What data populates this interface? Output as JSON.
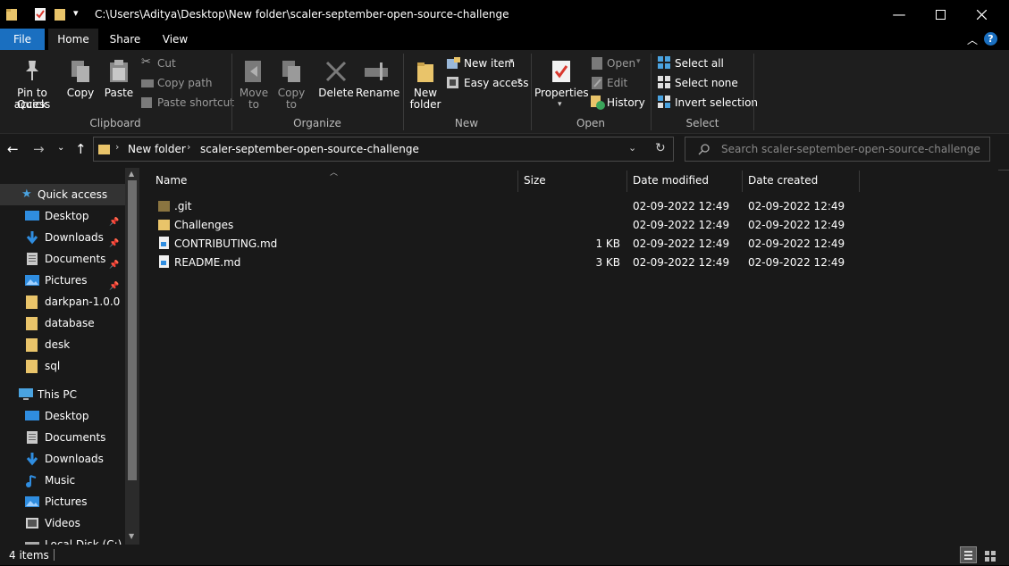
{
  "titlebar": {
    "path": "C:\\Users\\Aditya\\Desktop\\New folder\\scaler-september-open-source-challenge",
    "qat_dropdown": "▾"
  },
  "tabs": {
    "file": "File",
    "home": "Home",
    "share": "Share",
    "view": "View"
  },
  "ribbon": {
    "clipboard": {
      "pin_line1": "Pin to Quick",
      "pin_line2": "access",
      "copy": "Copy",
      "paste": "Paste",
      "cut": "Cut",
      "copy_path": "Copy path",
      "paste_shortcut": "Paste shortcut",
      "label": "Clipboard"
    },
    "organize": {
      "move_line1": "Move",
      "move_line2": "to",
      "copy_line1": "Copy",
      "copy_line2": "to",
      "delete": "Delete",
      "rename": "Rename",
      "label": "Organize"
    },
    "new": {
      "folder_line1": "New",
      "folder_line2": "folder",
      "new_item": "New item",
      "easy_access": "Easy access",
      "label": "New"
    },
    "open": {
      "properties": "Properties",
      "open": "Open",
      "edit": "Edit",
      "history": "History",
      "label": "Open"
    },
    "select": {
      "select_all": "Select all",
      "select_none": "Select none",
      "invert": "Invert selection",
      "label": "Select"
    }
  },
  "address": {
    "crumbs": [
      "New folder",
      "scaler-september-open-source-challenge"
    ],
    "search_placeholder": "Search scaler-september-open-source-challenge"
  },
  "nav": {
    "quick_access": "Quick access",
    "quick_items": [
      {
        "label": "Desktop",
        "icon": "desktop-icon",
        "pinned": true
      },
      {
        "label": "Downloads",
        "icon": "download-icon",
        "pinned": true
      },
      {
        "label": "Documents",
        "icon": "documents-icon",
        "pinned": true
      },
      {
        "label": "Pictures",
        "icon": "pictures-icon",
        "pinned": true
      },
      {
        "label": "darkpan-1.0.0",
        "icon": "folder-icon",
        "pinned": false
      },
      {
        "label": "database",
        "icon": "folder-icon",
        "pinned": false
      },
      {
        "label": "desk",
        "icon": "folder-icon",
        "pinned": false
      },
      {
        "label": "sql",
        "icon": "folder-icon",
        "pinned": false
      }
    ],
    "this_pc": "This PC",
    "pc_items": [
      {
        "label": "Desktop",
        "icon": "desktop-icon"
      },
      {
        "label": "Documents",
        "icon": "documents-icon"
      },
      {
        "label": "Downloads",
        "icon": "download-icon"
      },
      {
        "label": "Music",
        "icon": "music-icon"
      },
      {
        "label": "Pictures",
        "icon": "pictures-icon"
      },
      {
        "label": "Videos",
        "icon": "videos-icon"
      },
      {
        "label": "Local Disk (C:)",
        "icon": "drive-icon"
      }
    ]
  },
  "columns": {
    "name": "Name",
    "size": "Size",
    "modified": "Date modified",
    "created": "Date created"
  },
  "files": [
    {
      "name": ".git",
      "size": "",
      "modified": "02-09-2022 12:49",
      "created": "02-09-2022 12:49",
      "type": "hidden-folder"
    },
    {
      "name": "Challenges",
      "size": "",
      "modified": "02-09-2022 12:49",
      "created": "02-09-2022 12:49",
      "type": "folder"
    },
    {
      "name": "CONTRIBUTING.md",
      "size": "1 KB",
      "modified": "02-09-2022 12:49",
      "created": "02-09-2022 12:49",
      "type": "file"
    },
    {
      "name": "README.md",
      "size": "3 KB",
      "modified": "02-09-2022 12:49",
      "created": "02-09-2022 12:49",
      "type": "file"
    }
  ],
  "status": {
    "count": "4 items"
  },
  "colors": {
    "accent": "#1a6fc0",
    "folder": "#e9c46a",
    "background": "#191919",
    "ribbon": "#1e1e1e"
  }
}
